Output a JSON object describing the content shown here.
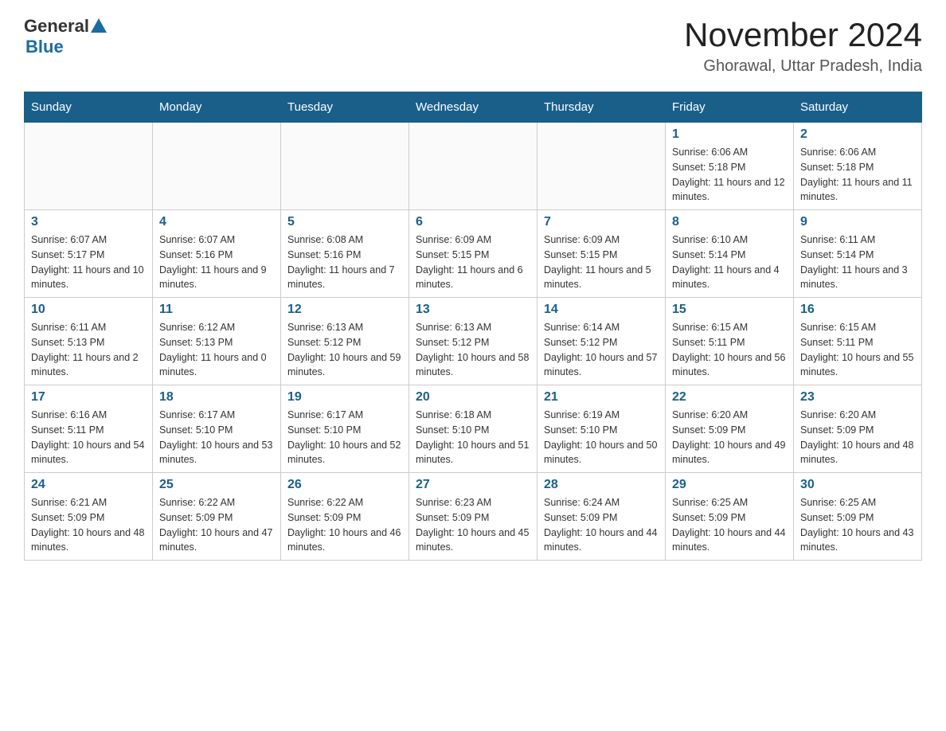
{
  "logo": {
    "general": "General",
    "blue": "Blue"
  },
  "title": "November 2024",
  "subtitle": "Ghorawal, Uttar Pradesh, India",
  "days_of_week": [
    "Sunday",
    "Monday",
    "Tuesday",
    "Wednesday",
    "Thursday",
    "Friday",
    "Saturday"
  ],
  "weeks": [
    [
      {
        "day": null,
        "info": null
      },
      {
        "day": null,
        "info": null
      },
      {
        "day": null,
        "info": null
      },
      {
        "day": null,
        "info": null
      },
      {
        "day": null,
        "info": null
      },
      {
        "day": "1",
        "info": "Sunrise: 6:06 AM\nSunset: 5:18 PM\nDaylight: 11 hours and 12 minutes."
      },
      {
        "day": "2",
        "info": "Sunrise: 6:06 AM\nSunset: 5:18 PM\nDaylight: 11 hours and 11 minutes."
      }
    ],
    [
      {
        "day": "3",
        "info": "Sunrise: 6:07 AM\nSunset: 5:17 PM\nDaylight: 11 hours and 10 minutes."
      },
      {
        "day": "4",
        "info": "Sunrise: 6:07 AM\nSunset: 5:16 PM\nDaylight: 11 hours and 9 minutes."
      },
      {
        "day": "5",
        "info": "Sunrise: 6:08 AM\nSunset: 5:16 PM\nDaylight: 11 hours and 7 minutes."
      },
      {
        "day": "6",
        "info": "Sunrise: 6:09 AM\nSunset: 5:15 PM\nDaylight: 11 hours and 6 minutes."
      },
      {
        "day": "7",
        "info": "Sunrise: 6:09 AM\nSunset: 5:15 PM\nDaylight: 11 hours and 5 minutes."
      },
      {
        "day": "8",
        "info": "Sunrise: 6:10 AM\nSunset: 5:14 PM\nDaylight: 11 hours and 4 minutes."
      },
      {
        "day": "9",
        "info": "Sunrise: 6:11 AM\nSunset: 5:14 PM\nDaylight: 11 hours and 3 minutes."
      }
    ],
    [
      {
        "day": "10",
        "info": "Sunrise: 6:11 AM\nSunset: 5:13 PM\nDaylight: 11 hours and 2 minutes."
      },
      {
        "day": "11",
        "info": "Sunrise: 6:12 AM\nSunset: 5:13 PM\nDaylight: 11 hours and 0 minutes."
      },
      {
        "day": "12",
        "info": "Sunrise: 6:13 AM\nSunset: 5:12 PM\nDaylight: 10 hours and 59 minutes."
      },
      {
        "day": "13",
        "info": "Sunrise: 6:13 AM\nSunset: 5:12 PM\nDaylight: 10 hours and 58 minutes."
      },
      {
        "day": "14",
        "info": "Sunrise: 6:14 AM\nSunset: 5:12 PM\nDaylight: 10 hours and 57 minutes."
      },
      {
        "day": "15",
        "info": "Sunrise: 6:15 AM\nSunset: 5:11 PM\nDaylight: 10 hours and 56 minutes."
      },
      {
        "day": "16",
        "info": "Sunrise: 6:15 AM\nSunset: 5:11 PM\nDaylight: 10 hours and 55 minutes."
      }
    ],
    [
      {
        "day": "17",
        "info": "Sunrise: 6:16 AM\nSunset: 5:11 PM\nDaylight: 10 hours and 54 minutes."
      },
      {
        "day": "18",
        "info": "Sunrise: 6:17 AM\nSunset: 5:10 PM\nDaylight: 10 hours and 53 minutes."
      },
      {
        "day": "19",
        "info": "Sunrise: 6:17 AM\nSunset: 5:10 PM\nDaylight: 10 hours and 52 minutes."
      },
      {
        "day": "20",
        "info": "Sunrise: 6:18 AM\nSunset: 5:10 PM\nDaylight: 10 hours and 51 minutes."
      },
      {
        "day": "21",
        "info": "Sunrise: 6:19 AM\nSunset: 5:10 PM\nDaylight: 10 hours and 50 minutes."
      },
      {
        "day": "22",
        "info": "Sunrise: 6:20 AM\nSunset: 5:09 PM\nDaylight: 10 hours and 49 minutes."
      },
      {
        "day": "23",
        "info": "Sunrise: 6:20 AM\nSunset: 5:09 PM\nDaylight: 10 hours and 48 minutes."
      }
    ],
    [
      {
        "day": "24",
        "info": "Sunrise: 6:21 AM\nSunset: 5:09 PM\nDaylight: 10 hours and 48 minutes."
      },
      {
        "day": "25",
        "info": "Sunrise: 6:22 AM\nSunset: 5:09 PM\nDaylight: 10 hours and 47 minutes."
      },
      {
        "day": "26",
        "info": "Sunrise: 6:22 AM\nSunset: 5:09 PM\nDaylight: 10 hours and 46 minutes."
      },
      {
        "day": "27",
        "info": "Sunrise: 6:23 AM\nSunset: 5:09 PM\nDaylight: 10 hours and 45 minutes."
      },
      {
        "day": "28",
        "info": "Sunrise: 6:24 AM\nSunset: 5:09 PM\nDaylight: 10 hours and 44 minutes."
      },
      {
        "day": "29",
        "info": "Sunrise: 6:25 AM\nSunset: 5:09 PM\nDaylight: 10 hours and 44 minutes."
      },
      {
        "day": "30",
        "info": "Sunrise: 6:25 AM\nSunset: 5:09 PM\nDaylight: 10 hours and 43 minutes."
      }
    ]
  ]
}
